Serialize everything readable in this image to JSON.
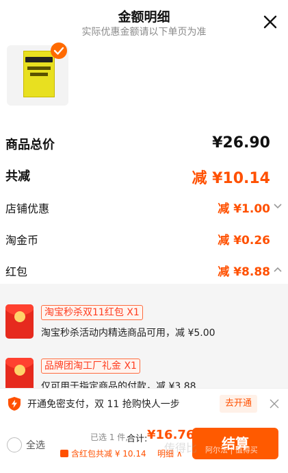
{
  "header": {
    "title": "金额明细",
    "subtitle": "实际优惠金额请以下单页为准"
  },
  "product": {
    "image": "book-cover",
    "selected": true
  },
  "summary": {
    "total_label": "商品总价",
    "total_value": "¥26.90",
    "discount_label": "共减",
    "discount_value": "减 ¥10.14",
    "items": [
      {
        "label": "店铺优惠",
        "value": "减 ¥1.00",
        "chevron": "down"
      },
      {
        "label": "淘金币",
        "value": "减 ¥0.26",
        "chevron": ""
      },
      {
        "label": "红包",
        "value": "减 ¥8.88",
        "chevron": "up"
      }
    ]
  },
  "coupons": [
    {
      "tag": "淘宝秒杀双11红包 X1",
      "desc": "淘宝秒杀活动内精选商品可用，减 ¥5.00"
    },
    {
      "tag": "品牌团淘工厂礼金 X1",
      "desc": "仅可用于指定商品的付款，减 ¥3.88"
    }
  ],
  "tip": {
    "text": "开通免密支付，双 11 抢购快人一步",
    "button": "去开通"
  },
  "footer": {
    "select_all": "全选",
    "selected_count": "已选 1 件,",
    "total_label": "合计:",
    "total": "¥16.76",
    "redpacket": "含红包共减 ¥ 10.14",
    "detail": "明细 ∧",
    "checkout": "结算",
    "watermark_1": "传得比",
    "watermark_2": "阿尔法 | 值得买"
  },
  "colors": {
    "accent": "#ff5000",
    "checkout_bg": "#ff5a00",
    "coupon_red": "#e62a1e"
  }
}
